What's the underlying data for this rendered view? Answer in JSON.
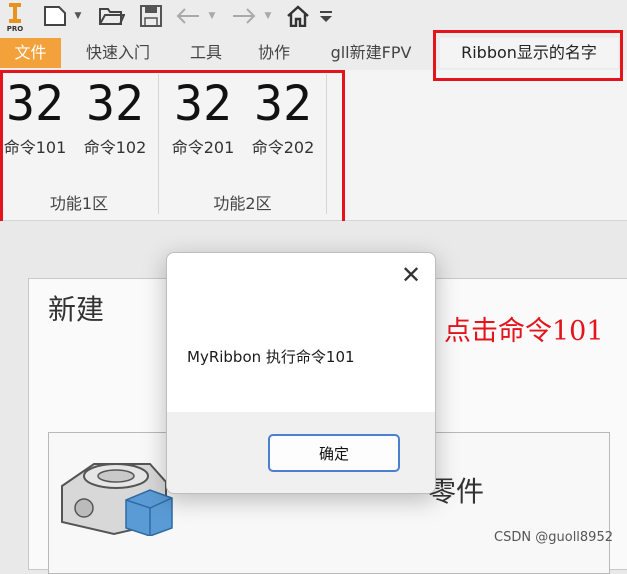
{
  "quick_access": {
    "logo_text": "PRO",
    "icons": [
      "app-logo-icon",
      "new-file-icon",
      "open-folder-icon",
      "save-icon",
      "undo-icon",
      "redo-icon",
      "home-icon",
      "customize-dropdown-icon"
    ]
  },
  "tabs": [
    "文件",
    "快速入门",
    "工具",
    "协作",
    "gll新建FPV",
    "Ribbon显示的名字"
  ],
  "ribbon": {
    "groups": [
      {
        "label": "功能1区",
        "commands": [
          {
            "label": "命令101"
          },
          {
            "label": "命令102"
          }
        ]
      },
      {
        "label": "功能2区",
        "commands": [
          {
            "label": "命令201"
          },
          {
            "label": "命令202"
          }
        ]
      }
    ],
    "icon_digits": "32"
  },
  "document": {
    "new_title": "新建",
    "annotation": "点击命令101",
    "part_label": "零件"
  },
  "dialog": {
    "message": "MyRibbon 执行命令101",
    "ok_label": "确定",
    "close_glyph": "✕"
  },
  "watermark": "CSDN @guoll8952",
  "colors": {
    "file_tab": "#f3a13a",
    "annotation_red": "#e3141b",
    "dialog_button_border": "#4c7fd0"
  }
}
